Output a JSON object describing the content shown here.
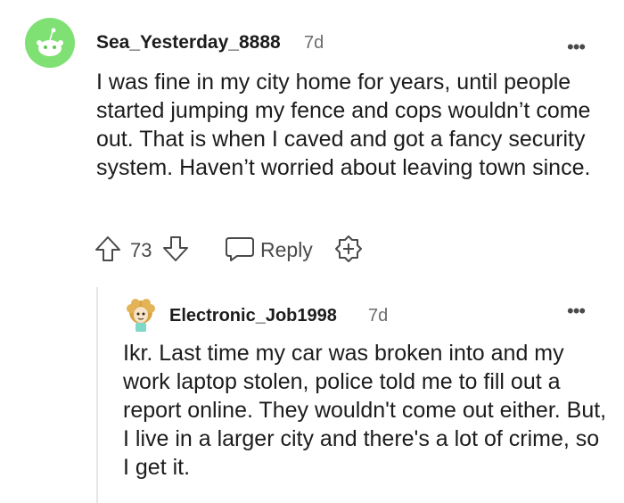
{
  "comment": {
    "username": "Sea_Yesterday_8888",
    "timestamp": "7d",
    "more_label": "•••",
    "body": "I was fine in my city home for years, until people started jumping my fence and cops wouldn’t come out. That is when I caved and got a fancy security system. Haven’t worried about leaving town since.",
    "score": "73",
    "reply_label": "Reply",
    "avatar_color": "#7fe074"
  },
  "reply": {
    "username": "Electronic_Job1998",
    "timestamp": "7d",
    "more_label": "•••",
    "body": "Ikr. Last time my car was broken into and my work laptop stolen, police told me to fill out a report online. They wouldn't come out either. But, I live in a larger city and there's a lot of crime, so I get it."
  }
}
